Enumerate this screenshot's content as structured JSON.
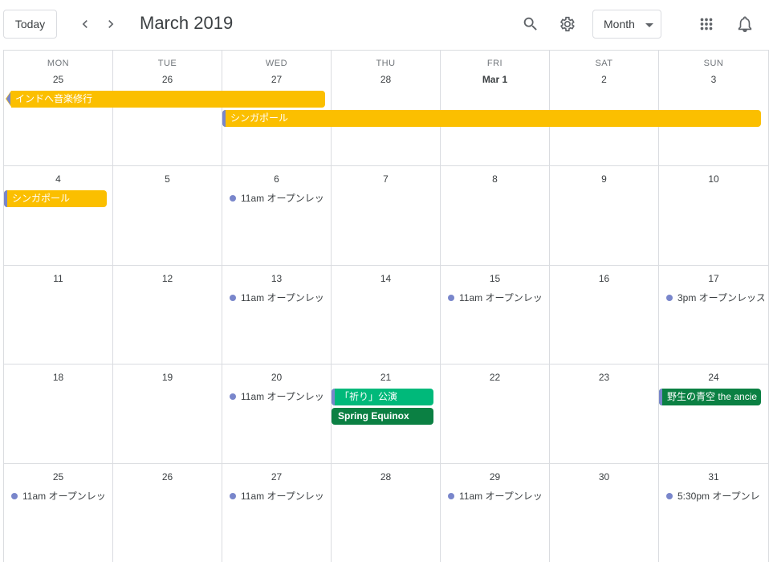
{
  "header": {
    "today_label": "Today",
    "title": "March 2019",
    "view_label": "Month"
  },
  "dow": [
    "MON",
    "TUE",
    "WED",
    "THU",
    "FRI",
    "SAT",
    "SUN"
  ],
  "weeks": [
    {
      "days": [
        "25",
        "26",
        "27",
        "28",
        "Mar 1",
        "2",
        "3"
      ]
    },
    {
      "days": [
        "4",
        "5",
        "6",
        "7",
        "8",
        "9",
        "10"
      ]
    },
    {
      "days": [
        "11",
        "12",
        "13",
        "14",
        "15",
        "16",
        "17"
      ]
    },
    {
      "days": [
        "18",
        "19",
        "20",
        "21",
        "22",
        "23",
        "24"
      ]
    },
    {
      "days": [
        "25",
        "26",
        "27",
        "28",
        "29",
        "30",
        "31"
      ]
    }
  ],
  "events": {
    "india_music": "インドへ音楽修行",
    "singapore_1": "シンガポール",
    "singapore_2": "シンガポール",
    "open_mar6": "11am オープンレッ",
    "open_mar13": "11am オープンレッ",
    "open_mar15": "11am オープンレッ",
    "open_mar17": "3pm オープンレッス",
    "open_mar20": "11am オープンレッ",
    "inori": "「祈り」公演",
    "spring_equinox": "Spring Equinox",
    "yasei": "野生の青空 the ancie",
    "open_mar25": "11am オープンレッ",
    "open_mar27": "11am オープンレッ",
    "open_mar29": "11am オープンレッ",
    "open_mar31": "5:30pm オープンレ"
  },
  "colors": {
    "yellow": "#fbbf00",
    "green": "#00b97a",
    "dark_green": "#0b8043",
    "lavender": "#7986cb"
  }
}
